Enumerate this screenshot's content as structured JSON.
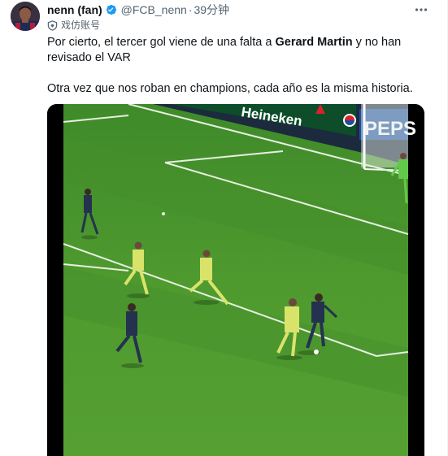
{
  "author": {
    "display_name": "nenn (fan)",
    "handle": "@FCB_nenn",
    "separator": "·",
    "time": "39分钟",
    "label": "戏仿账号",
    "avatar_icon": "person-avatar",
    "verified_icon": "verified-badge-icon",
    "label_icon": "shield-icon",
    "more_icon": "more-dots-icon"
  },
  "tweet": {
    "line1_pre": "Por cierto, el tercer gol viene de una falta a ",
    "line1_bold": "Gerard Martin",
    "line1_post": " y no han",
    "line2": "revisado el VAR",
    "line3": "Otra vez que nos roban en champions, cada año es la misma historia."
  },
  "media": {
    "type": "video-frame",
    "board_text_1": "Heineken",
    "board_text_2": "PEPS",
    "colors": {
      "pitch": "#4e9a2e",
      "pitch_dark": "#3f8425",
      "line": "#e6efe0",
      "yellow_kit": "#d9e36a",
      "dark_kit": "#24324f",
      "keeper_kit": "#63c94b",
      "letterbox": "#000000"
    }
  },
  "colors": {
    "text": "#0f1419",
    "secondary": "#536471",
    "verified": "#1d9bf0"
  }
}
